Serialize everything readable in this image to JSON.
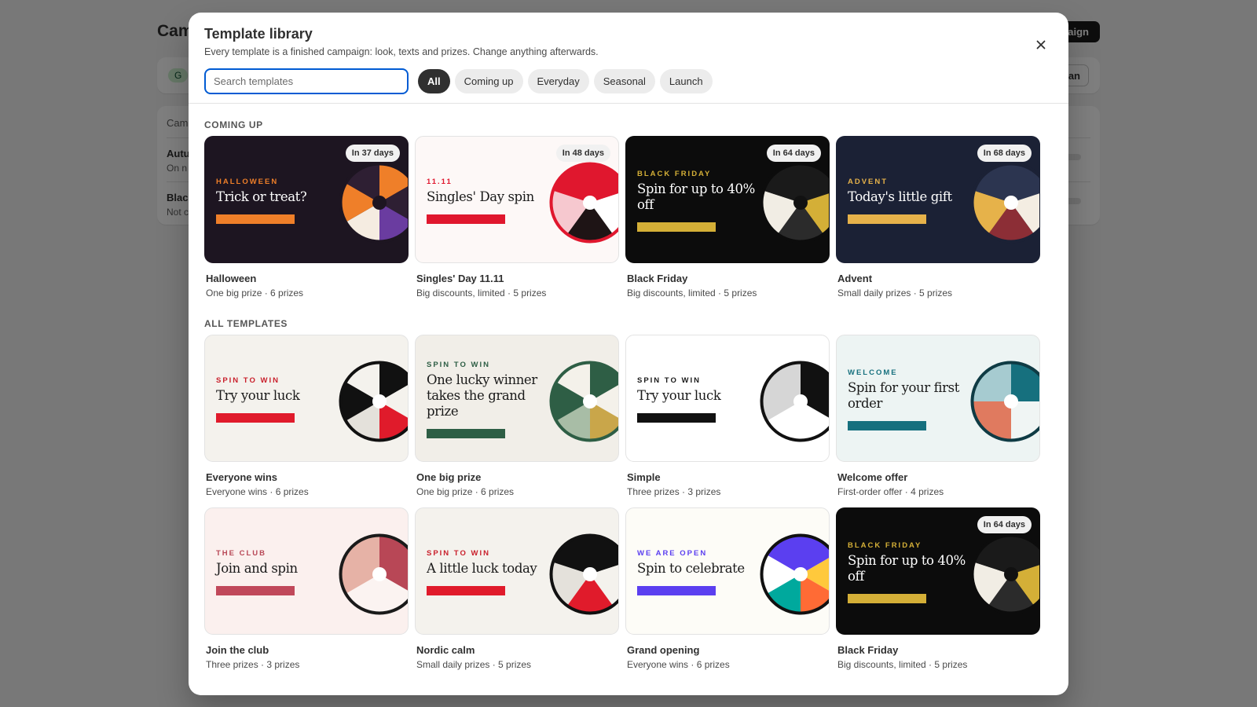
{
  "background": {
    "page_title": "Cam",
    "create_label": "aign",
    "badge_label": "G",
    "plan_label": "an",
    "table_header": "Cam",
    "rows": [
      {
        "name": "Autu",
        "sub": "On n"
      },
      {
        "name": "Blac",
        "sub": "Not c"
      }
    ]
  },
  "modal": {
    "title": "Template library",
    "subtitle": "Every template is a finished campaign: look, texts and prizes. Change anything afterwards.",
    "close_icon": "close-icon",
    "search": {
      "placeholder": "Search templates",
      "value": ""
    },
    "filters": [
      {
        "label": "All",
        "active": true
      },
      {
        "label": "Coming up",
        "active": false
      },
      {
        "label": "Everyday",
        "active": false
      },
      {
        "label": "Seasonal",
        "active": false
      },
      {
        "label": "Launch",
        "active": false
      }
    ],
    "sections": [
      {
        "title": "COMING UP"
      },
      {
        "title": "ALL TEMPLATES"
      }
    ],
    "cards": [
      {
        "name": "Halloween",
        "meta": "One big prize · 6 prizes",
        "eyebrow": "HALLOWEEN",
        "headline": "Trick or treat?",
        "badge": "In 37 days",
        "colors": {
          "bg": "#1d1521",
          "eyebrow": "#ef7f29",
          "headline": "#ffffff",
          "cta": "#ef7f29",
          "rim": "#1d1521",
          "hub": "#1d1521",
          "wedges": [
            "#ef7f29",
            "#2e1f33",
            "#6a3ca0",
            "#f5ece1",
            "#ef7f29",
            "#2e1f33"
          ]
        }
      },
      {
        "name": "Singles' Day 11.11",
        "meta": "Big discounts, limited · 5 prizes",
        "eyebrow": "11.11",
        "headline": "Singles' Day spin",
        "badge": "In 48 days",
        "colors": {
          "bg": "#fdf8f7",
          "eyebrow": "#e0172e",
          "headline": "#1a1a1a",
          "cta": "#e0172e",
          "rim": "#e0172e",
          "hub": "#ffffff",
          "wedges": [
            "#e0172e",
            "#ffffff",
            "#1e1415",
            "#f6c8cf",
            "#e0172e"
          ]
        }
      },
      {
        "name": "Black Friday",
        "meta": "Big discounts, limited · 5 prizes",
        "eyebrow": "BLACK FRIDAY",
        "headline": "Spin for up to 40% off",
        "badge": "In 64 days",
        "colors": {
          "bg": "#0c0c0c",
          "eyebrow": "#d4af37",
          "headline": "#ffffff",
          "cta": "#d4af37",
          "rim": "#0c0c0c",
          "hub": "#111111",
          "wedges": [
            "#1a1a1a",
            "#d4af37",
            "#2b2b2b",
            "#f1ede4",
            "#1a1a1a"
          ]
        }
      },
      {
        "name": "Advent",
        "meta": "Small daily prizes · 5 prizes",
        "eyebrow": "ADVENT",
        "headline": "Today's little gift",
        "badge": "In 68 days",
        "colors": {
          "bg": "#1b2135",
          "eyebrow": "#e6b24a",
          "headline": "#ffffff",
          "cta": "#e6b24a",
          "rim": "#1b2135",
          "hub": "#ffffff",
          "wedges": [
            "#2c3550",
            "#f4ede2",
            "#8c2e36",
            "#e6b24a",
            "#2c3550"
          ]
        }
      },
      {
        "name": "Everyone wins",
        "meta": "Everyone wins · 6 prizes",
        "eyebrow": "SPIN TO WIN",
        "headline": "Try your luck",
        "colors": {
          "bg": "#f4f2ed",
          "eyebrow": "#c9202c",
          "headline": "#1a1a1a",
          "cta": "#e01b2b",
          "rim": "#111111",
          "hub": "#ffffff",
          "wedges": [
            "#111111",
            "#f4f2ed",
            "#e01b2b",
            "#e4e1db",
            "#111111",
            "#f4f2ed"
          ]
        }
      },
      {
        "name": "One big prize",
        "meta": "One big prize · 6 prizes",
        "eyebrow": "SPIN TO WIN",
        "headline": "One lucky winner takes the grand prize",
        "colors": {
          "bg": "#f1eee8",
          "eyebrow": "#2e5e45",
          "headline": "#1a1a1a",
          "cta": "#2e5e45",
          "rim": "#2e5e45",
          "hub": "#ffffff",
          "wedges": [
            "#2e5e45",
            "#f4f1ea",
            "#c9a64a",
            "#a8bda6",
            "#2e5e45",
            "#f4f1ea"
          ]
        }
      },
      {
        "name": "Simple",
        "meta": "Three prizes · 3 prizes",
        "eyebrow": "SPIN TO WIN",
        "headline": "Try your luck",
        "colors": {
          "bg": "#ffffff",
          "eyebrow": "#1a1a1a",
          "headline": "#1a1a1a",
          "cta": "#111111",
          "rim": "#111111",
          "hub": "#ffffff",
          "wedges": [
            "#111111",
            "#ffffff",
            "#d6d6d6"
          ]
        }
      },
      {
        "name": "Welcome offer",
        "meta": "First-order offer · 4 prizes",
        "eyebrow": "WELCOME",
        "headline": "Spin for your first order",
        "colors": {
          "bg": "#edf4f3",
          "eyebrow": "#16707e",
          "headline": "#1a1a1a",
          "cta": "#16707e",
          "rim": "#0f3b44",
          "hub": "#ffffff",
          "wedges": [
            "#16707e",
            "#f0f5f4",
            "#e07a5f",
            "#a6cbd0"
          ]
        }
      },
      {
        "name": "Join the club",
        "meta": "Three prizes · 3 prizes",
        "eyebrow": "THE CLUB",
        "headline": "Join and spin",
        "colors": {
          "bg": "#fbf0ee",
          "eyebrow": "#b84756",
          "headline": "#1a1a1a",
          "cta": "#c0485a",
          "rim": "#1a1a1a",
          "hub": "#ffffff",
          "wedges": [
            "#b84756",
            "#fbf3f1",
            "#e6b2a6"
          ]
        }
      },
      {
        "name": "Nordic calm",
        "meta": "Small daily prizes · 5 prizes",
        "eyebrow": "SPIN TO WIN",
        "headline": "A little luck today",
        "colors": {
          "bg": "#f4f2ed",
          "eyebrow": "#c9202c",
          "headline": "#1a1a1a",
          "cta": "#e01b2b",
          "rim": "#111111",
          "hub": "#ffffff",
          "wedges": [
            "#111111",
            "#f4f2ed",
            "#e01b2b",
            "#e4e1db",
            "#111111"
          ]
        }
      },
      {
        "name": "Grand opening",
        "meta": "Everyone wins · 6 prizes",
        "eyebrow": "WE ARE OPEN",
        "headline": "Spin to celebrate",
        "colors": {
          "bg": "#fdfcf7",
          "eyebrow": "#5b3ff0",
          "headline": "#1a1a1a",
          "cta": "#5b3ff0",
          "rim": "#111111",
          "hub": "#ffffff",
          "wedges": [
            "#5b3ff0",
            "#ffc93c",
            "#ff6b35",
            "#00a99d",
            "#ffffff",
            "#5b3ff0"
          ]
        }
      },
      {
        "name": "Black Friday",
        "meta": "Big discounts, limited · 5 prizes",
        "eyebrow": "BLACK FRIDAY",
        "headline": "Spin for up to 40% off",
        "badge": "In 64 days",
        "colors": {
          "bg": "#0c0c0c",
          "eyebrow": "#d4af37",
          "headline": "#ffffff",
          "cta": "#d4af37",
          "rim": "#0c0c0c",
          "hub": "#111111",
          "wedges": [
            "#1a1a1a",
            "#d4af37",
            "#2b2b2b",
            "#f1ede4",
            "#1a1a1a"
          ]
        }
      }
    ]
  }
}
